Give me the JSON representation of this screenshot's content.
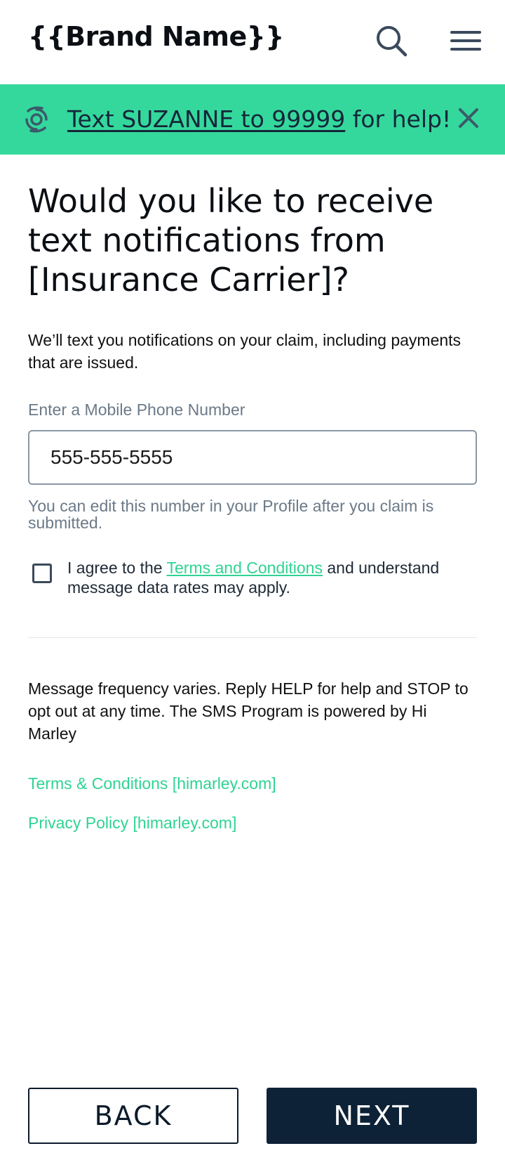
{
  "header": {
    "brand": "{{Brand Name}}",
    "search_icon": "search-icon",
    "menu_icon": "hamburger-menu-icon"
  },
  "banner": {
    "icon": "hurricane-icon",
    "link_text": "Text SUZANNE to 99999",
    "suffix": " for help!",
    "close_icon": "close-icon",
    "background": "#35d89c"
  },
  "main": {
    "title": "Would you like to receive text notifications from [Insurance Carrier]?",
    "description": "We’ll text you notifications on your claim, including payments that are issued.",
    "phone_label": "Enter a Mobile Phone Number",
    "phone_value": "555-555-5555",
    "helper": "You can edit this number in your Profile after you claim is submitted.",
    "agree_prefix": "I agree to the ",
    "agree_link": "Terms and Conditions",
    "agree_suffix": " and understand message data rates may apply.",
    "frequency": "Message frequency varies. Reply HELP for help and STOP to opt out at any time. The SMS Program is powered by Hi Marley",
    "terms_link": "Terms & Conditions [himarley.com]",
    "privacy_link": "Privacy Policy [himarley.com]"
  },
  "footer": {
    "back_label": "BACK",
    "next_label": "NEXT"
  },
  "colors": {
    "accent": "#2fd394",
    "primary_dark": "#0d2236"
  }
}
